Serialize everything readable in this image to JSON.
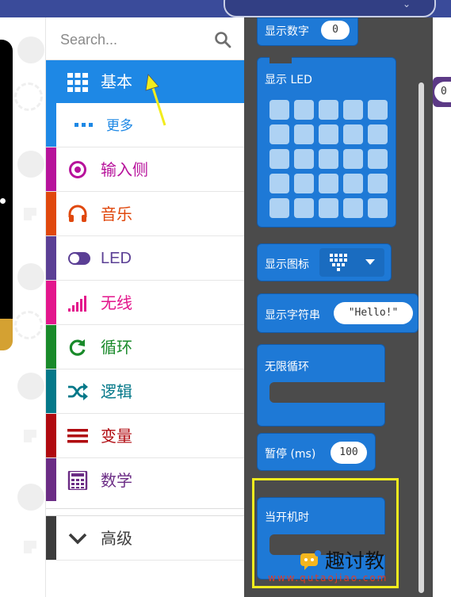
{
  "search": {
    "placeholder": "Search..."
  },
  "toolbox": {
    "categories": [
      {
        "id": "basic",
        "label": "基本",
        "color": "#1e88e5",
        "icon": "grid-icon"
      },
      {
        "id": "more",
        "label": "更多",
        "color": "#1e88e5",
        "icon": "more-dots-icon"
      },
      {
        "id": "input",
        "label": "输入侧",
        "color": "#b7129b",
        "icon": "target-icon"
      },
      {
        "id": "music",
        "label": "音乐",
        "color": "#e0480d",
        "icon": "headphones-icon"
      },
      {
        "id": "led",
        "label": "LED",
        "color": "#5b3f95",
        "icon": "toggle-icon"
      },
      {
        "id": "radio",
        "label": "无线",
        "color": "#e3168c",
        "icon": "signal-bars-icon"
      },
      {
        "id": "loops",
        "label": "循环",
        "color": "#198a2a",
        "icon": "refresh-icon"
      },
      {
        "id": "logic",
        "label": "逻辑",
        "color": "#047889",
        "icon": "shuffle-icon"
      },
      {
        "id": "variables",
        "label": "变量",
        "color": "#b0090f",
        "icon": "list-lines-icon"
      },
      {
        "id": "math",
        "label": "数学",
        "color": "#6b2c85",
        "icon": "calculator-icon"
      },
      {
        "id": "advanced",
        "label": "高级",
        "color": "#3c3c3c",
        "icon": "chevron-down-icon"
      }
    ]
  },
  "flyout": {
    "show_number": {
      "label": "显示数字",
      "value": "0"
    },
    "show_leds": {
      "label": "显示 LED"
    },
    "show_icon": {
      "label": "显示图标",
      "icon": "heart-icon"
    },
    "show_string": {
      "label": "显示字符串",
      "value": "\"Hello!\""
    },
    "forever": {
      "label": "无限循环"
    },
    "pause": {
      "label": "暂停 (ms)",
      "value": "100"
    },
    "on_start": {
      "label": "当开机时"
    }
  },
  "workspace": {
    "value": "0"
  },
  "watermark": {
    "title": "趣讨教",
    "url": "www.qutaojiao.com"
  }
}
